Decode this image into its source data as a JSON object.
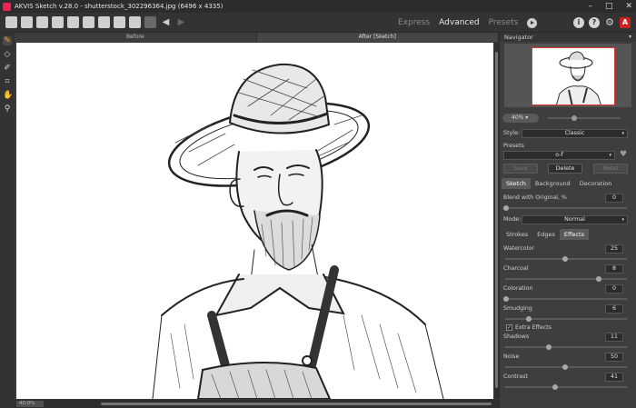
{
  "window": {
    "title": "AKVIS Sketch v.28.0 - shutterstock_302296364.jpg (6496 x 4335)",
    "controls": [
      "–",
      "□",
      "✕"
    ]
  },
  "toolbar": {
    "modes": [
      "Express",
      "Advanced",
      "Presets"
    ],
    "active_mode": "Advanced"
  },
  "canvas": {
    "tab_before": "Before",
    "tab_after": "After [Sketch]",
    "zoom_status": "40.0%"
  },
  "navigator": {
    "header": "Navigator",
    "zoom": "40%",
    "zoom_slider_fraction": 0.33
  },
  "settings": {
    "style_label": "Style:",
    "style_value": "Classic",
    "presets_label": "Presets",
    "preset_value": "o-f",
    "btn_save": "Save",
    "btn_delete": "Delete",
    "btn_reset": "Reset",
    "main_tabs": [
      "Sketch",
      "Background",
      "Decoration"
    ],
    "blend_label": "Blend with Original, %",
    "blend_value": "0",
    "mode_label": "Mode:",
    "mode_value": "Normal",
    "sub_tabs": [
      "Strokes",
      "Edges",
      "Effects"
    ],
    "watercolor_label": "Watercolor",
    "watercolor_value": "25",
    "charcoal_label": "Charcoal",
    "charcoal_value": "8",
    "coloration_label": "Coloration",
    "coloration_value": "0",
    "smudging_label": "Smudging",
    "smudging_value": "6",
    "extra_label": "Extra Effects",
    "extra_checked": "✓",
    "shadows_label": "Shadows",
    "shadows_value": "11",
    "noise_label": "Noise",
    "noise_value": "50",
    "contrast_label": "Contrast",
    "contrast_value": "41"
  },
  "colors": {
    "accent_tool": "#f5a623",
    "logo_red": "#c22"
  }
}
